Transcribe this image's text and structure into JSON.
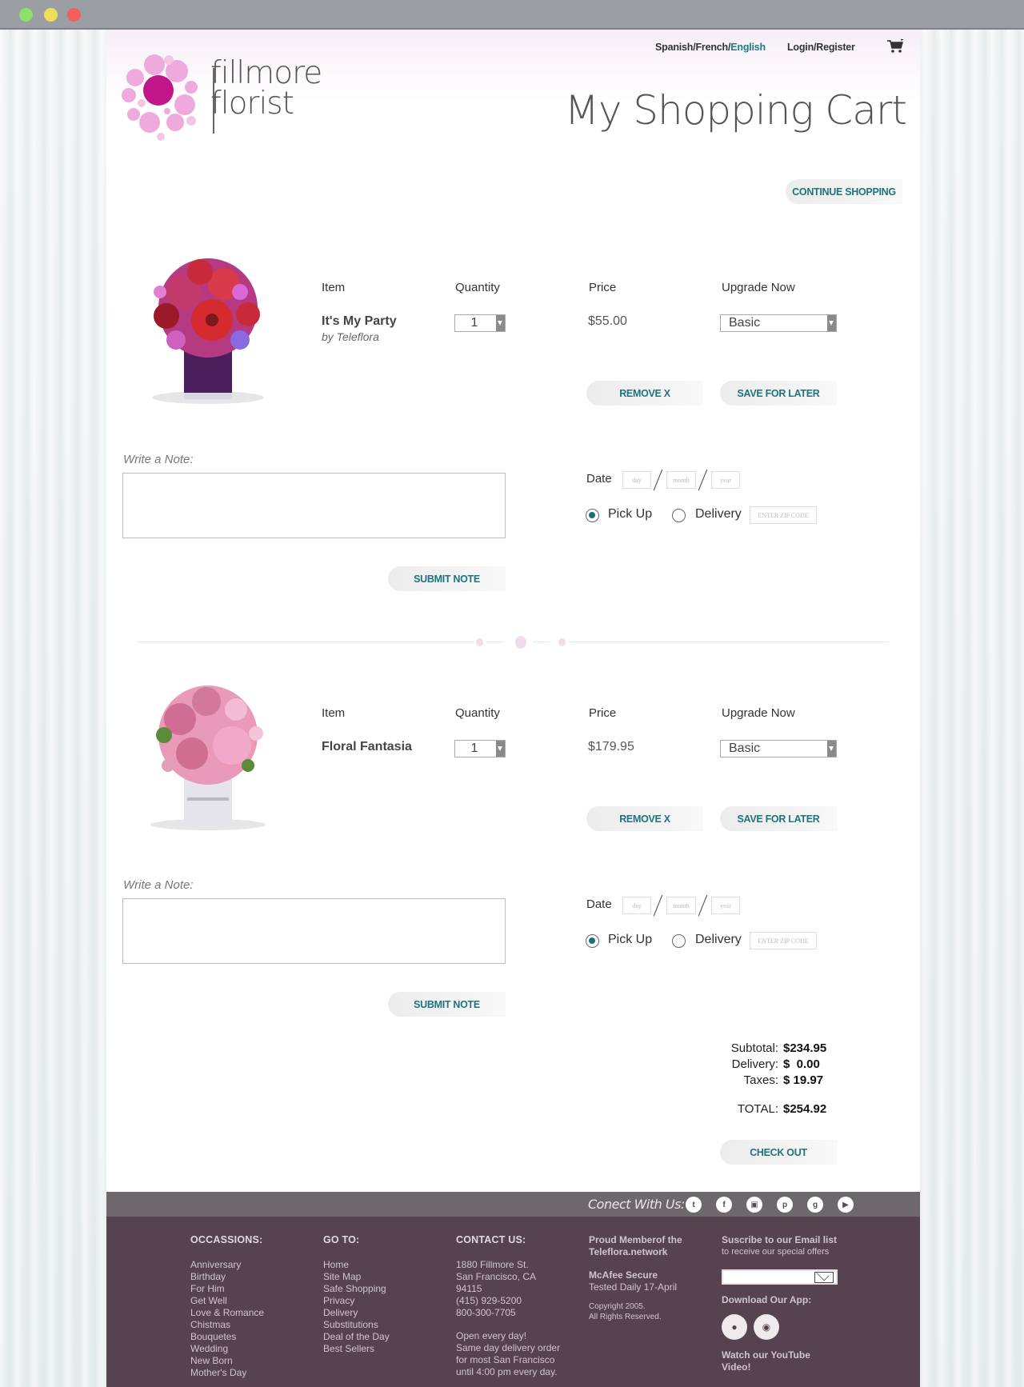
{
  "window": {
    "controls": [
      "close",
      "minimize",
      "maximize"
    ]
  },
  "header": {
    "languages": {
      "spanish": "Spanish/",
      "french": "French/",
      "english": "English"
    },
    "login": "Login/Register",
    "cart_icon": "cart-icon",
    "logo": {
      "line1": "fillmore",
      "line2": "florist"
    },
    "title": "My Shopping Cart",
    "continue_shopping": "CONTINUE SHOPPING"
  },
  "labels": {
    "item": "Item",
    "quantity": "Quantity",
    "price": "Price",
    "upgrade": "Upgrade Now",
    "remove": "REMOVE   X",
    "save_for_later": "SAVE FOR LATER",
    "write_note": "Write a Note:",
    "submit_note": "SUBMIT NOTE",
    "date": "Date",
    "day_placeholder": "day",
    "month_placeholder": "month",
    "year_placeholder": "year",
    "pick_up": "Pick Up",
    "delivery": "Delivery",
    "zip_placeholder": "ENTER ZIP CODE"
  },
  "items": [
    {
      "name": "It's My Party",
      "by": "by Teleflora",
      "quantity": "1",
      "price": "$55.00",
      "upgrade": "Basic",
      "note": "",
      "fulfillment": "pick_up"
    },
    {
      "name": "Floral Fantasia",
      "by": "",
      "quantity": "1",
      "price": "$179.95",
      "upgrade": "Basic",
      "note": "",
      "fulfillment": "pick_up"
    }
  ],
  "totals": {
    "subtotal_label": "Subtotal:",
    "subtotal": "$234.95",
    "delivery_label": "Delivery:",
    "delivery": "$  0.00",
    "taxes_label": "Taxes:",
    "taxes": "$ 19.97",
    "total_label": "TOTAL:",
    "total": "$254.92",
    "checkout": "CHECK OUT"
  },
  "social": {
    "label": "Conect With Us:",
    "icons": [
      "twitter-icon",
      "facebook-icon",
      "instagram-icon",
      "pinterest-icon",
      "google-plus-icon",
      "youtube-icon"
    ]
  },
  "footer": {
    "occasions": {
      "heading": "OCCASSIONS:",
      "links": [
        "Anniversary",
        "Birthday",
        "For Him",
        "Get Well",
        "Love & Romance",
        "Chistmas",
        "Bouquetes",
        "Wedding",
        "New Born",
        "Mother's Day"
      ]
    },
    "goto": {
      "heading": "GO TO:",
      "links": [
        "Home",
        "Site Map",
        "Safe Shopping",
        "Privacy",
        "Delivery",
        "Substitutions",
        "Deal of the Day",
        "Best Sellers"
      ]
    },
    "contact": {
      "heading": "CONTACT US:",
      "address": [
        "1880 Fillmore St.",
        "San Francisco, CA",
        "94115",
        "(415) 929-5200",
        "800-300-7705"
      ],
      "hours": [
        "Open every day!",
        "Same day delivery order",
        "for most San Francisco",
        "until 4:00 pm every day."
      ]
    },
    "member": {
      "line1": "Proud Memberof the",
      "line2": "Teleflora.network",
      "mcafee_title": "McAfee Secure",
      "mcafee_sub": "Tested Daily 17-April",
      "copyright1": "Copyright 2005.",
      "copyright2": "All Rights Reserved."
    },
    "subscribe": {
      "title": "Suscribe to our Email list",
      "sub": "to receive our special offers",
      "email_value": "",
      "download": "Download Our App:",
      "youtube1": "Watch our YouTube",
      "youtube2": "Video!"
    }
  },
  "colors": {
    "accent_teal": "#1f737d",
    "brand_magenta": "#c0168a",
    "brand_pink": "#eaa6dc",
    "footer_bg": "#56434f",
    "social_bar_bg": "#6e676b"
  }
}
